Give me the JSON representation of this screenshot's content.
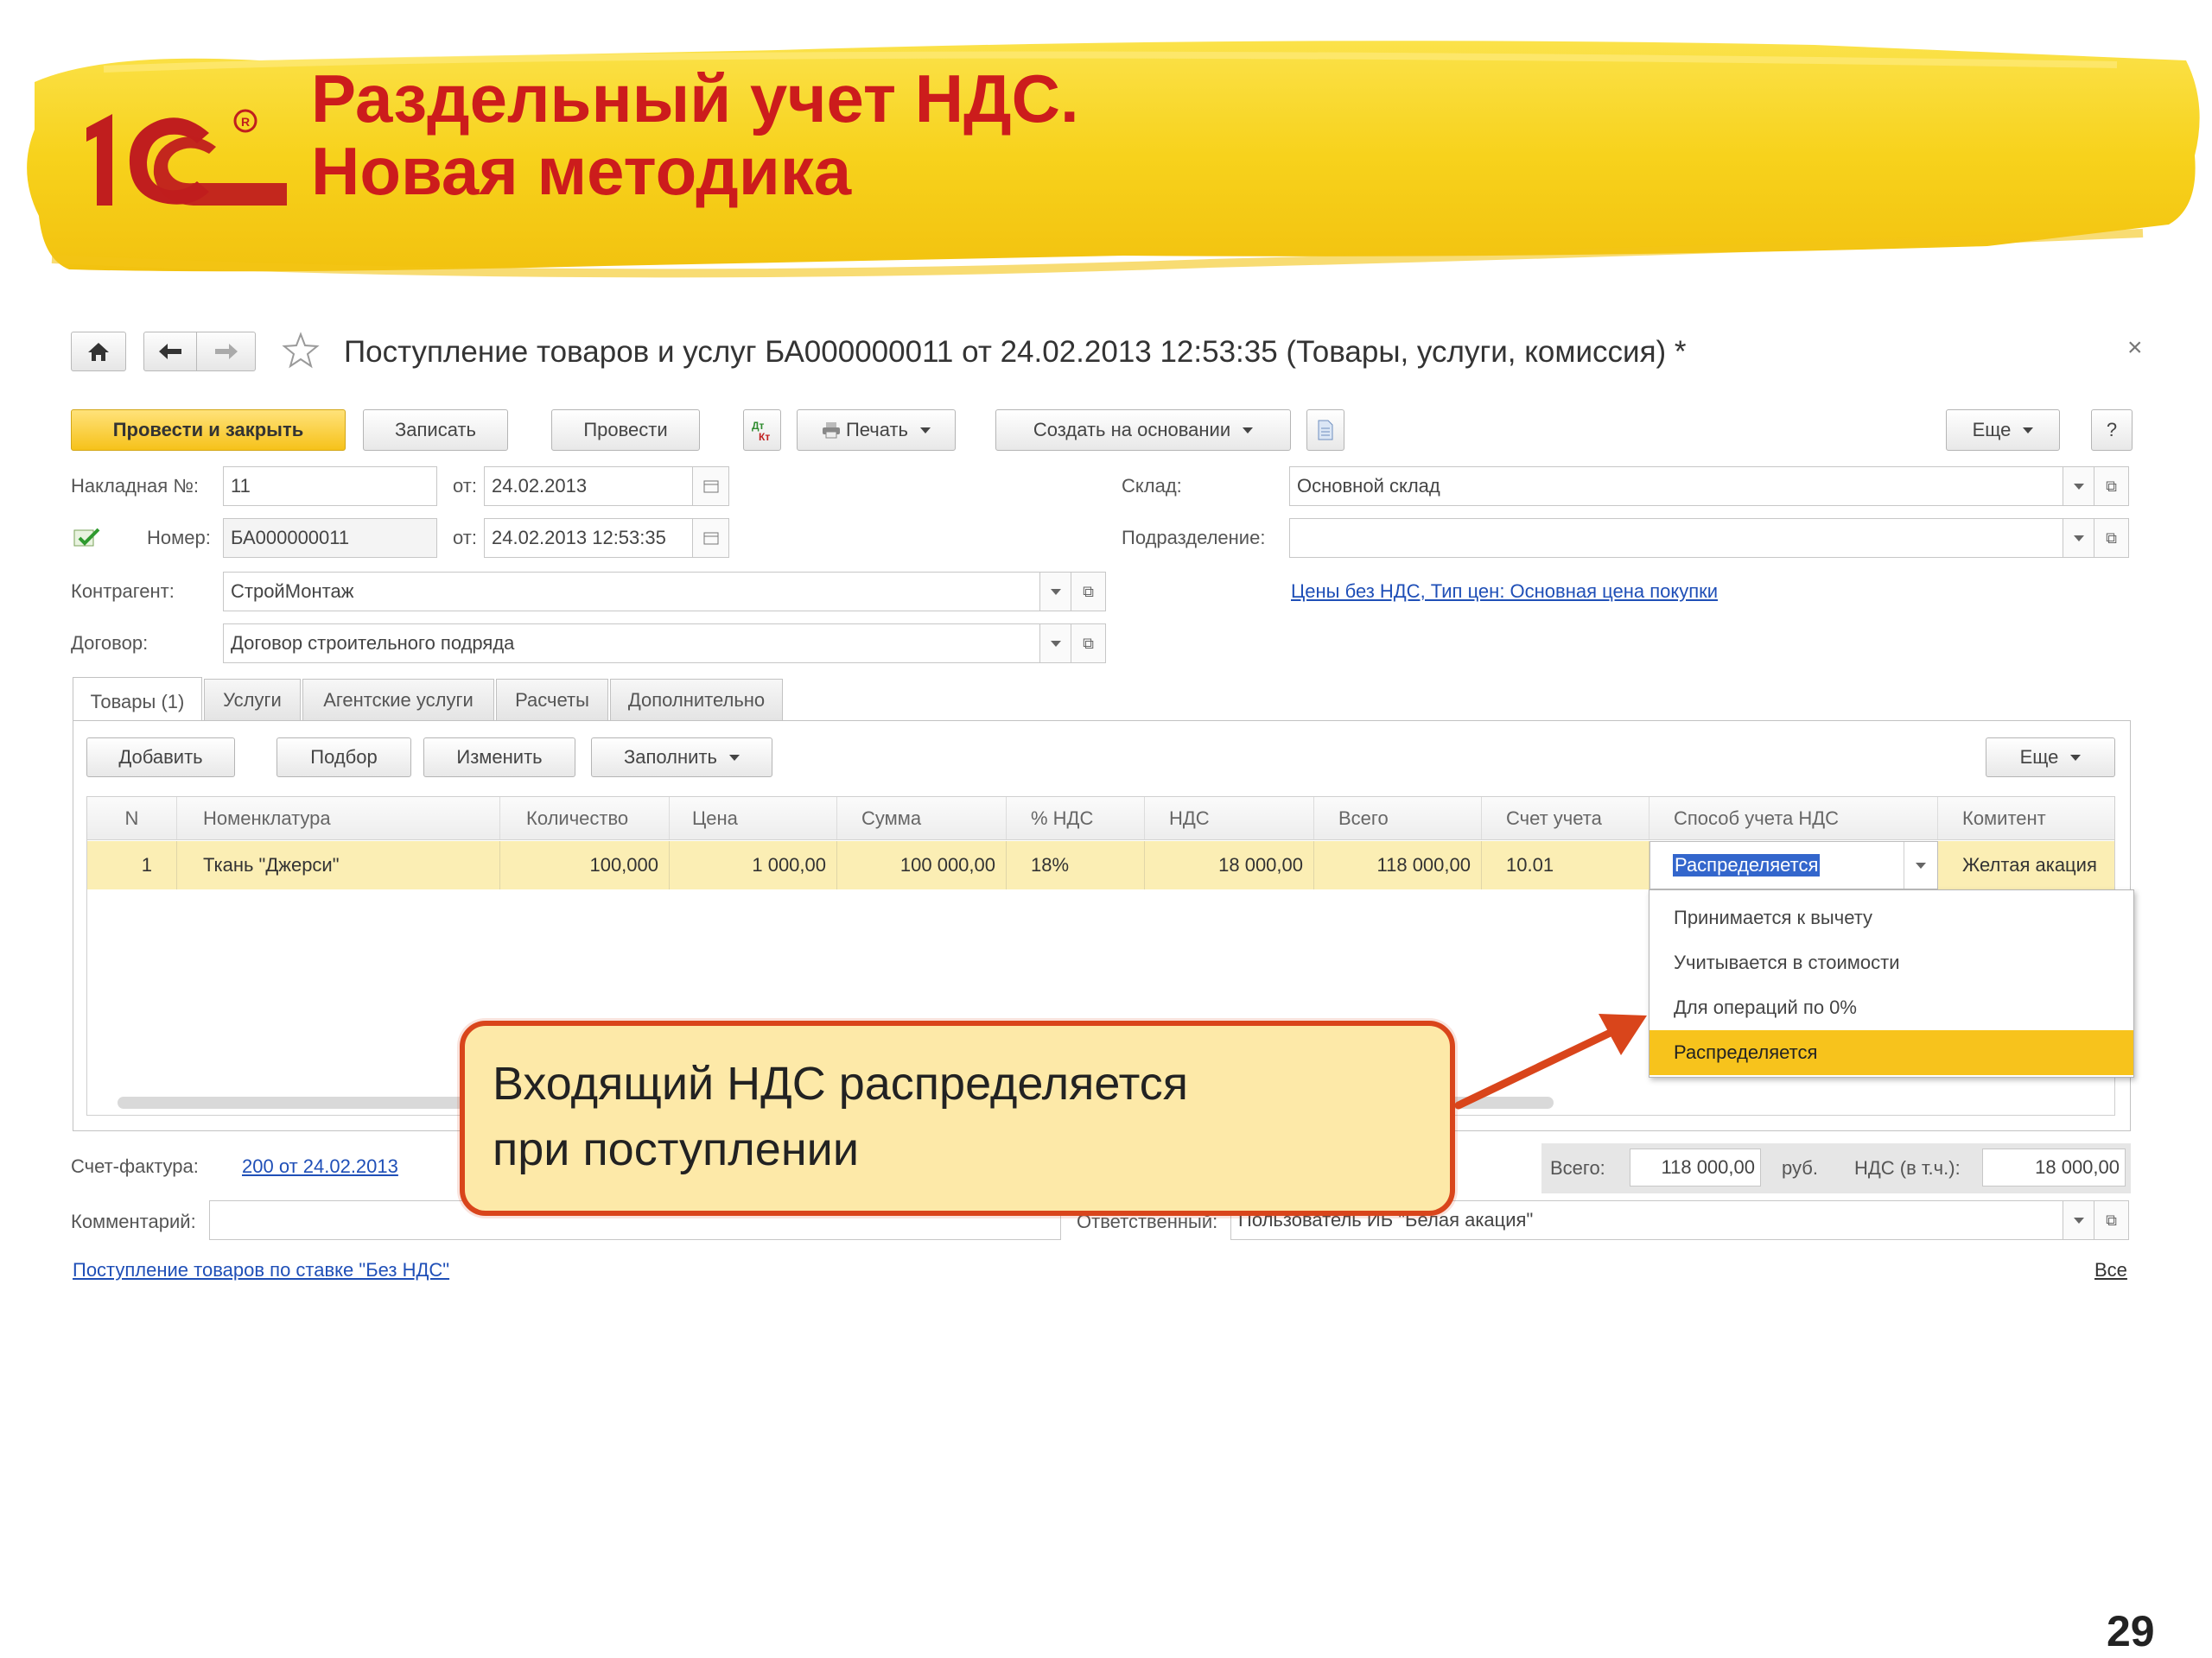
{
  "slide": {
    "title_line1": "Раздельный учет НДС.",
    "title_line2": "Новая методика",
    "page_number": "29",
    "logo_text": "1С"
  },
  "window": {
    "title": "Поступление товаров и услуг БА000000011 от 24.02.2013 12:53:35 (Товары, услуги, комиссия) *",
    "close_symbol": "×"
  },
  "toolbar": {
    "post_close": "Провести и закрыть",
    "save": "Записать",
    "post": "Провести",
    "print": "Печать",
    "create_based": "Создать на основании",
    "more": "Еще",
    "help": "?"
  },
  "form": {
    "invoice_label": "Накладная  №:",
    "invoice_value": "11",
    "from_label": "от:",
    "invoice_date": "24.02.2013",
    "number_label": "Номер:",
    "number_value": "БА000000011",
    "number_date": "24.02.2013 12:53:35",
    "counterparty_label": "Контрагент:",
    "counterparty_value": "СтройМонтаж",
    "contract_label": "Договор:",
    "contract_value": "Договор строительного подряда",
    "warehouse_label": "Склад:",
    "warehouse_value": "Основной склад",
    "division_label": "Подразделение:",
    "division_value": "",
    "prices_link": "Цены без НДС, Тип цен: Основная цена покупки"
  },
  "tabs": [
    "Товары (1)",
    "Услуги",
    "Агентские услуги",
    "Расчеты",
    "Дополнительно"
  ],
  "table_toolbar": {
    "add": "Добавить",
    "pick": "Подбор",
    "change": "Изменить",
    "fill": "Заполнить",
    "more": "Еще"
  },
  "table": {
    "headers": [
      "N",
      "Номенклатура",
      "Количество",
      "Цена",
      "Сумма",
      "% НДС",
      "НДС",
      "Всего",
      "Счет учета",
      "Способ учета НДС",
      "Комитент"
    ],
    "row": [
      "1",
      "Ткань \"Джерси\"",
      "100,000",
      "1 000,00",
      "100 000,00",
      "18%",
      "18 000,00",
      "118 000,00",
      "10.01",
      "Распределяется",
      "Желтая акация"
    ]
  },
  "dropdown": {
    "options": [
      "Принимается к вычету",
      "Учитывается в стоимости",
      "Для операций по 0%",
      "Распределяется"
    ],
    "selected": "Распределяется"
  },
  "callout": {
    "line1": "Входящий НДС распределяется",
    "line2": "при поступлении"
  },
  "footer": {
    "invoice_label": "Счет-фактура:",
    "invoice_link": "200 от 24.02.2013",
    "total_label": "Всего:",
    "total_value": "118 000,00",
    "currency": "руб.",
    "vat_label": "НДС (в т.ч.):",
    "vat_value": "18 000,00",
    "comment_label": "Комментарий:",
    "comment_value": "",
    "responsible_label": "Ответственный:",
    "responsible_value": "Пользователь ИБ \"Белая акация\"",
    "bottom_link": "Поступление товаров по ставке \"Без НДС\"",
    "all_link": "Все"
  },
  "colors": {
    "banner_yellow": "#f7d21c",
    "title_red": "#cc1c1c",
    "accent_orange": "#d9451b",
    "selection_yellow": "#f7c31c",
    "link_blue": "#1f4fb7"
  }
}
